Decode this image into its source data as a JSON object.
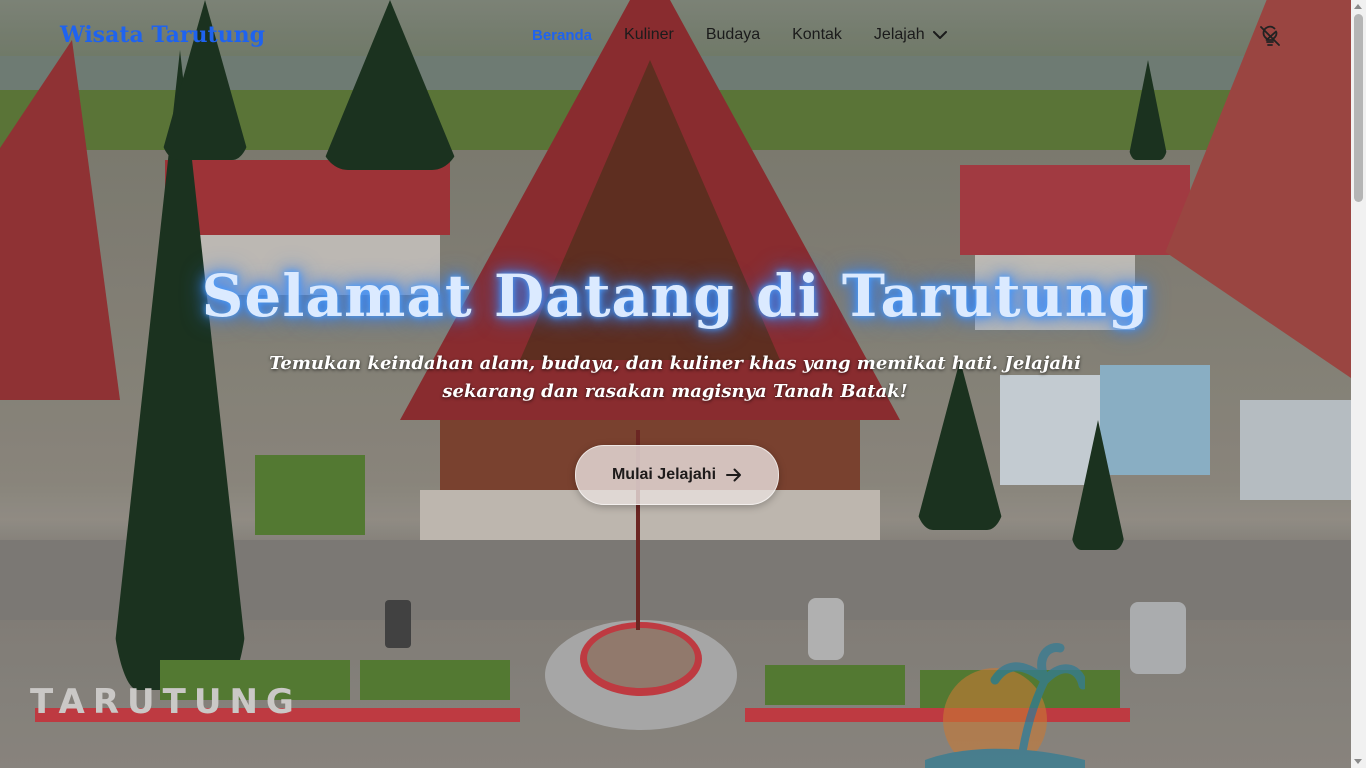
{
  "brand": "Wisata Tarutung",
  "nav": {
    "items": [
      "Beranda",
      "Kuliner",
      "Budaya",
      "Kontak"
    ],
    "dropdown_label": "Jelajah",
    "active_color": "#1f63ef"
  },
  "hero": {
    "title": "Selamat Datang di Tarutung",
    "subtitle_line1": "Temukan keindahan alam, budaya, dan kuliner khas yang memikat hati. Jelajahi",
    "subtitle_line2": "sekarang dan rasakan magisnya Tanah Batak!",
    "cta_label": "Mulai Jelajahi"
  },
  "scene_sign": "TARUTUNG",
  "icons": {
    "theme_toggle": "lightbulb-off-icon",
    "cta_arrow": "arrow-right-icon",
    "dropdown": "chevron-down-icon"
  }
}
